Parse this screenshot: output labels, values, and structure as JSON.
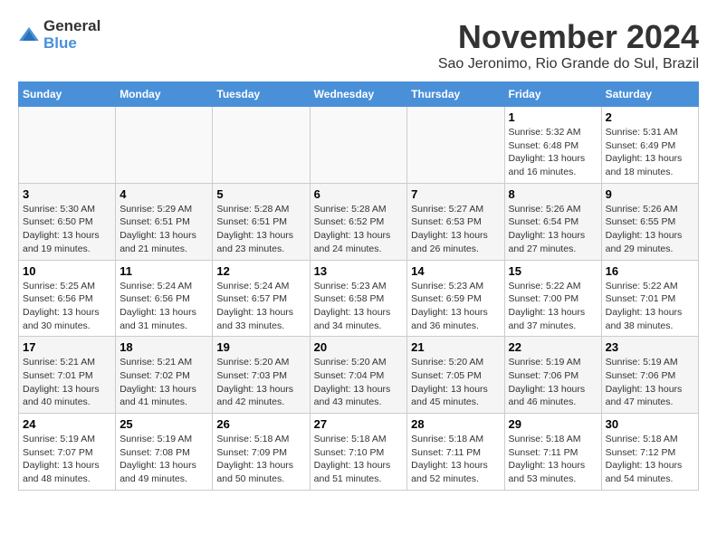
{
  "logo": {
    "general": "General",
    "blue": "Blue"
  },
  "title": "November 2024",
  "location": "Sao Jeronimo, Rio Grande do Sul, Brazil",
  "weekdays": [
    "Sunday",
    "Monday",
    "Tuesday",
    "Wednesday",
    "Thursday",
    "Friday",
    "Saturday"
  ],
  "weeks": [
    [
      {
        "day": "",
        "info": ""
      },
      {
        "day": "",
        "info": ""
      },
      {
        "day": "",
        "info": ""
      },
      {
        "day": "",
        "info": ""
      },
      {
        "day": "",
        "info": ""
      },
      {
        "day": "1",
        "info": "Sunrise: 5:32 AM\nSunset: 6:48 PM\nDaylight: 13 hours and 16 minutes."
      },
      {
        "day": "2",
        "info": "Sunrise: 5:31 AM\nSunset: 6:49 PM\nDaylight: 13 hours and 18 minutes."
      }
    ],
    [
      {
        "day": "3",
        "info": "Sunrise: 5:30 AM\nSunset: 6:50 PM\nDaylight: 13 hours and 19 minutes."
      },
      {
        "day": "4",
        "info": "Sunrise: 5:29 AM\nSunset: 6:51 PM\nDaylight: 13 hours and 21 minutes."
      },
      {
        "day": "5",
        "info": "Sunrise: 5:28 AM\nSunset: 6:51 PM\nDaylight: 13 hours and 23 minutes."
      },
      {
        "day": "6",
        "info": "Sunrise: 5:28 AM\nSunset: 6:52 PM\nDaylight: 13 hours and 24 minutes."
      },
      {
        "day": "7",
        "info": "Sunrise: 5:27 AM\nSunset: 6:53 PM\nDaylight: 13 hours and 26 minutes."
      },
      {
        "day": "8",
        "info": "Sunrise: 5:26 AM\nSunset: 6:54 PM\nDaylight: 13 hours and 27 minutes."
      },
      {
        "day": "9",
        "info": "Sunrise: 5:26 AM\nSunset: 6:55 PM\nDaylight: 13 hours and 29 minutes."
      }
    ],
    [
      {
        "day": "10",
        "info": "Sunrise: 5:25 AM\nSunset: 6:56 PM\nDaylight: 13 hours and 30 minutes."
      },
      {
        "day": "11",
        "info": "Sunrise: 5:24 AM\nSunset: 6:56 PM\nDaylight: 13 hours and 31 minutes."
      },
      {
        "day": "12",
        "info": "Sunrise: 5:24 AM\nSunset: 6:57 PM\nDaylight: 13 hours and 33 minutes."
      },
      {
        "day": "13",
        "info": "Sunrise: 5:23 AM\nSunset: 6:58 PM\nDaylight: 13 hours and 34 minutes."
      },
      {
        "day": "14",
        "info": "Sunrise: 5:23 AM\nSunset: 6:59 PM\nDaylight: 13 hours and 36 minutes."
      },
      {
        "day": "15",
        "info": "Sunrise: 5:22 AM\nSunset: 7:00 PM\nDaylight: 13 hours and 37 minutes."
      },
      {
        "day": "16",
        "info": "Sunrise: 5:22 AM\nSunset: 7:01 PM\nDaylight: 13 hours and 38 minutes."
      }
    ],
    [
      {
        "day": "17",
        "info": "Sunrise: 5:21 AM\nSunset: 7:01 PM\nDaylight: 13 hours and 40 minutes."
      },
      {
        "day": "18",
        "info": "Sunrise: 5:21 AM\nSunset: 7:02 PM\nDaylight: 13 hours and 41 minutes."
      },
      {
        "day": "19",
        "info": "Sunrise: 5:20 AM\nSunset: 7:03 PM\nDaylight: 13 hours and 42 minutes."
      },
      {
        "day": "20",
        "info": "Sunrise: 5:20 AM\nSunset: 7:04 PM\nDaylight: 13 hours and 43 minutes."
      },
      {
        "day": "21",
        "info": "Sunrise: 5:20 AM\nSunset: 7:05 PM\nDaylight: 13 hours and 45 minutes."
      },
      {
        "day": "22",
        "info": "Sunrise: 5:19 AM\nSunset: 7:06 PM\nDaylight: 13 hours and 46 minutes."
      },
      {
        "day": "23",
        "info": "Sunrise: 5:19 AM\nSunset: 7:06 PM\nDaylight: 13 hours and 47 minutes."
      }
    ],
    [
      {
        "day": "24",
        "info": "Sunrise: 5:19 AM\nSunset: 7:07 PM\nDaylight: 13 hours and 48 minutes."
      },
      {
        "day": "25",
        "info": "Sunrise: 5:19 AM\nSunset: 7:08 PM\nDaylight: 13 hours and 49 minutes."
      },
      {
        "day": "26",
        "info": "Sunrise: 5:18 AM\nSunset: 7:09 PM\nDaylight: 13 hours and 50 minutes."
      },
      {
        "day": "27",
        "info": "Sunrise: 5:18 AM\nSunset: 7:10 PM\nDaylight: 13 hours and 51 minutes."
      },
      {
        "day": "28",
        "info": "Sunrise: 5:18 AM\nSunset: 7:11 PM\nDaylight: 13 hours and 52 minutes."
      },
      {
        "day": "29",
        "info": "Sunrise: 5:18 AM\nSunset: 7:11 PM\nDaylight: 13 hours and 53 minutes."
      },
      {
        "day": "30",
        "info": "Sunrise: 5:18 AM\nSunset: 7:12 PM\nDaylight: 13 hours and 54 minutes."
      }
    ]
  ]
}
